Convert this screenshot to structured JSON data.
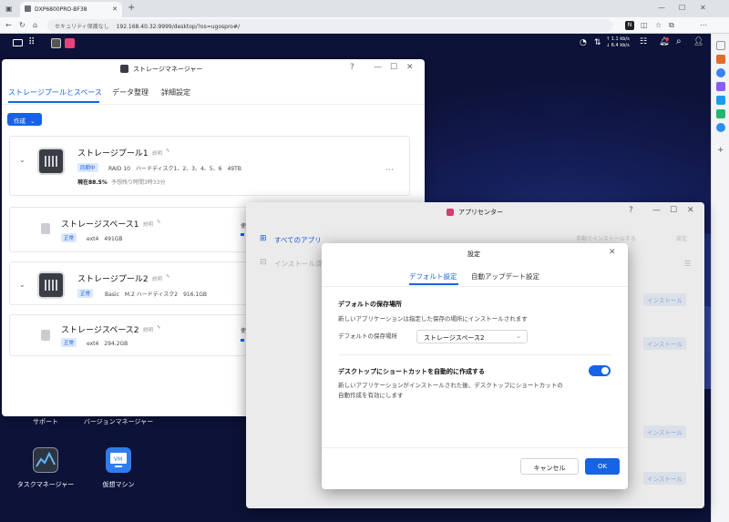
{
  "browser": {
    "tab_title": "DXP6800PRO-BF38",
    "url_security": "セキュリティ保護なし",
    "url": "192.168.40.32:9999/desktop/?os=ugospro#/"
  },
  "topbar": {
    "net_up": "↑ 1.1 kb/s",
    "net_down": "↓ 6.4 kb/s"
  },
  "desktop_icons": [
    {
      "label": "サポート"
    },
    {
      "label": "バージョンマネージャー"
    },
    {
      "label": "タスクマネージャー"
    },
    {
      "label": "仮想マシン"
    }
  ],
  "storage_manager": {
    "title": "ストレージマネージャー",
    "tabs": [
      "ストレージプールとスペース",
      "データ整理",
      "詳細設定"
    ],
    "create_button": "作成",
    "pools": [
      {
        "name": "ストレージプール1",
        "desc_label": "説明",
        "status": "同期中",
        "details": "RAID 10　ハードディスク1、2、3、4、5、6　49TB",
        "progress_label": "現在88.5%",
        "progress_value": 88.5,
        "remaining": "予想残り時間3時33分",
        "space": {
          "name": "ストレージスペース1",
          "desc_label": "説明",
          "status": "正常",
          "details": "ext4　491GB",
          "usage_label": "使"
        }
      },
      {
        "name": "ストレージプール2",
        "desc_label": "説明",
        "status": "正常",
        "details": "Basic　M.2 ハードディスク2　916.1GB",
        "space": {
          "name": "ストレージスペース2",
          "desc_label": "説明",
          "status": "正常",
          "details": "ext4　294.2GB",
          "usage_label": "使"
        }
      }
    ]
  },
  "app_center": {
    "title": "アプリセンター",
    "sidebar": [
      "すべてのアプリ",
      "インストール済"
    ],
    "toolbar": {
      "manual_install": "手動でインストールする",
      "settings": "設定"
    },
    "install_button": "インストール"
  },
  "settings_dialog": {
    "title": "設定",
    "tabs": [
      "デフォルト設定",
      "自動アップデート設定"
    ],
    "section1": {
      "title": "デフォルトの保存場所",
      "text": "新しいアプリケーションは指定した保存の場所にインストールされます",
      "field_label": "デフォルトの保存場所",
      "field_value": "ストレージスペース2"
    },
    "section2": {
      "title": "デスクトップにショートカットを自動的に作成する",
      "text_line1": "新しいアプリケーションがインストールされた後、デスクトップにショートカットの",
      "text_line2": "自動作成を有効にします",
      "toggle_on": true
    },
    "cancel": "キャンセル",
    "ok": "OK"
  },
  "colors": {
    "accent": "#1763e6",
    "desktop_bg": "#0e1338"
  }
}
